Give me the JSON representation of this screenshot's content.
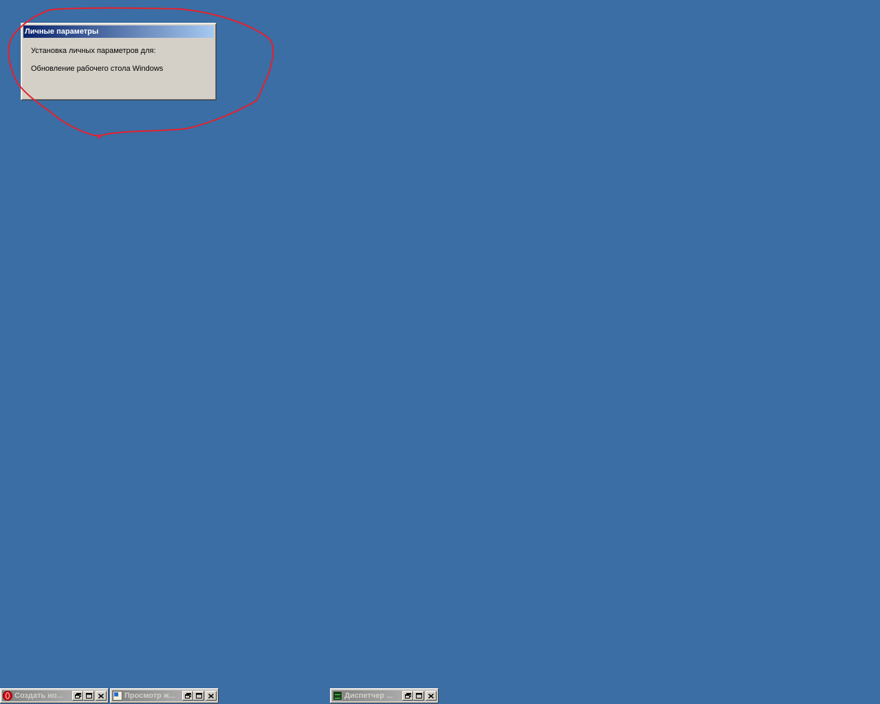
{
  "colors": {
    "desktop_background": "#3a6ea5",
    "dialog_face": "#d4d0c8",
    "active_title_start": "#0a246a",
    "active_title_end": "#a6caf0",
    "inactive_title_start": "#808080",
    "inactive_title_end": "#c0c0c0",
    "annotation_stroke": "#e8202a"
  },
  "dialog": {
    "title": "Личные параметры",
    "line1": "Установка личных параметров для:",
    "line2": "Обновление рабочего стола Windows"
  },
  "minimized_windows": [
    {
      "title": "Создать но...",
      "icon": "opera-icon"
    },
    {
      "title": "Просмотр ж...",
      "icon": "event-log-icon"
    },
    {
      "title": "Диспетчер ...",
      "icon": "task-manager-icon"
    }
  ]
}
